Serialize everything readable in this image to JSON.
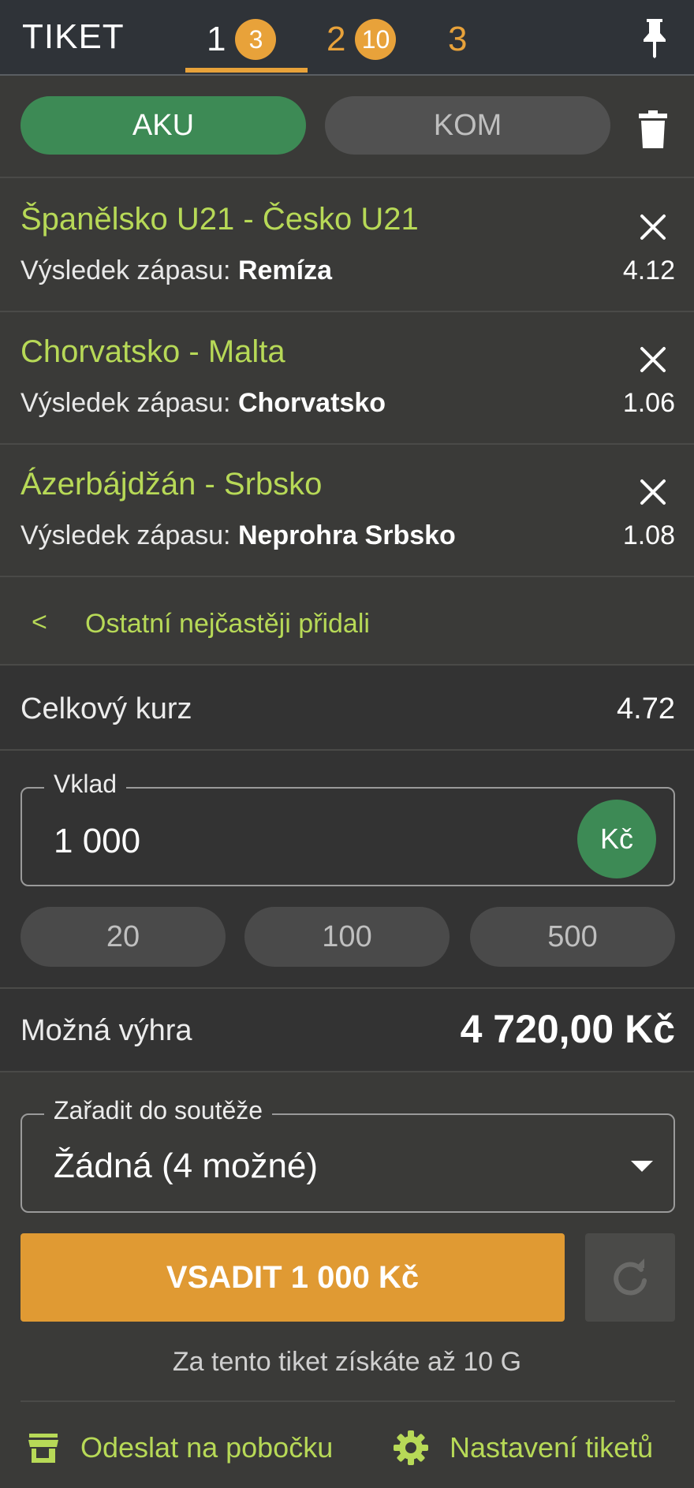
{
  "header": {
    "title": "TIKET",
    "tabs": [
      {
        "num": "1",
        "badge": "3"
      },
      {
        "num": "2",
        "badge": "10"
      },
      {
        "num": "3"
      }
    ]
  },
  "mode": {
    "aku": "AKU",
    "kom": "KOM"
  },
  "bets": [
    {
      "match": "Španělsko U21 - Česko U21",
      "label": "Výsledek zápasu:",
      "pick": "Remíza",
      "odd": "4.12"
    },
    {
      "match": "Chorvatsko - Malta",
      "label": "Výsledek zápasu:",
      "pick": "Chorvatsko",
      "odd": "1.06"
    },
    {
      "match": "Ázerbájdžán - Srbsko",
      "label": "Výsledek zápasu:",
      "pick": "Neprohra Srbsko",
      "odd": "1.08"
    }
  ],
  "suggest": {
    "chevron": "<",
    "label": "Ostatní nejčastěji přidali"
  },
  "total": {
    "label": "Celkový kurz",
    "value": "4.72"
  },
  "stake": {
    "legend": "Vklad",
    "value": "1 000",
    "currency": "Kč",
    "quick": [
      "20",
      "100",
      "500"
    ]
  },
  "win": {
    "label": "Možná výhra",
    "value": "4 720,00 Kč"
  },
  "competition": {
    "legend": "Zařadit do soutěže",
    "value": "Žádná (4 možné)"
  },
  "place_button": "VSADIT 1 000 Kč",
  "note": "Za tento tiket získáte až 10 G",
  "footer": {
    "branch": "Odeslat na pobočku",
    "settings": "Nastavení tiketů"
  },
  "colors": {
    "accent_green": "#b7d957",
    "orange": "#e8a23a",
    "primary_green": "#3d8a55"
  }
}
